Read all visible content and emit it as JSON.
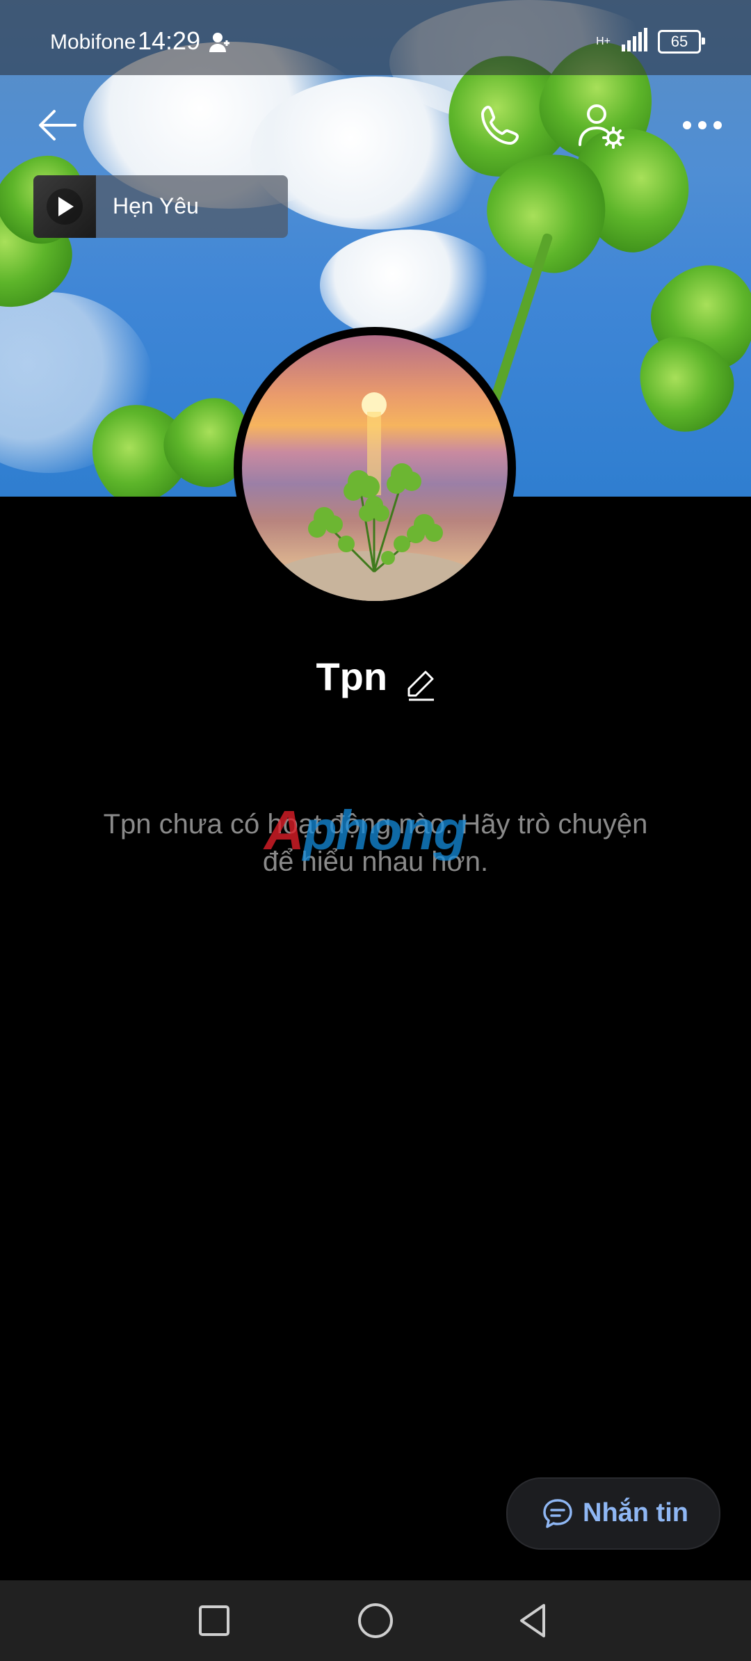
{
  "status_bar": {
    "carrier": "Mobifone",
    "time": "14:29",
    "battery": "65",
    "network": "H+"
  },
  "header": {
    "back_icon": "arrow-left-icon",
    "call_icon": "phone-icon",
    "settings_icon": "user-settings-icon",
    "more_icon": "more-horizontal-icon"
  },
  "music": {
    "title": "Hẹn Yêu"
  },
  "profile": {
    "name": "Tpn",
    "empty_message": "Tpn chưa có hoạt động nào. Hãy trò chuyện để hiểu nhau hơn."
  },
  "watermark": {
    "part1": "A",
    "part2": "phong"
  },
  "message_button": {
    "label": "Nhắn tin"
  },
  "nav": {
    "recent_icon": "square-icon",
    "home_icon": "circle-icon",
    "back_icon": "triangle-back-icon"
  },
  "colors": {
    "accent": "#8fb7f4",
    "background": "#000000"
  }
}
